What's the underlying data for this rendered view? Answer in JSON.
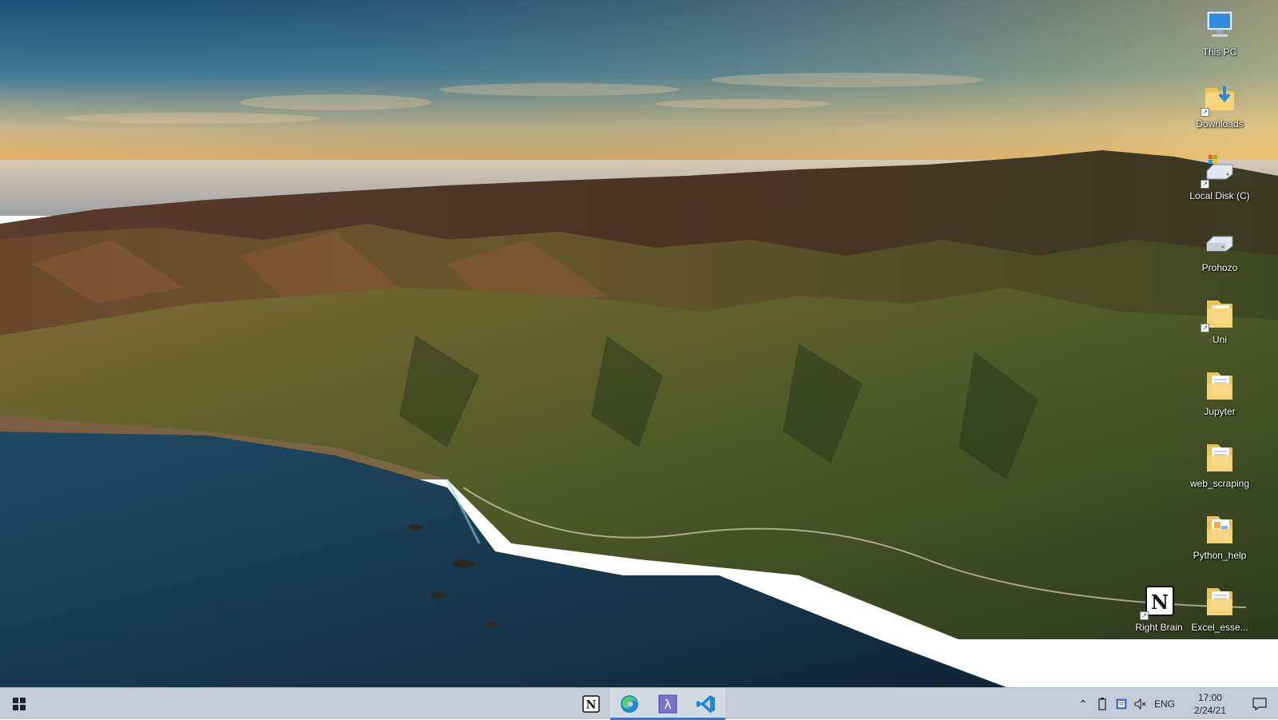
{
  "desktop": {
    "icons": [
      {
        "label": "This PC",
        "icon": "this-pc-icon"
      },
      {
        "label": "Downloads",
        "icon": "downloads-folder-icon"
      },
      {
        "label": "Local Disk (C)",
        "icon": "local-disk-icon"
      },
      {
        "label": "Prohozo",
        "icon": "drive-icon"
      },
      {
        "label": "Uni",
        "icon": "folder-icon"
      },
      {
        "label": "Jupyter",
        "icon": "folder-icon"
      },
      {
        "label": "web_scraping",
        "icon": "folder-icon"
      },
      {
        "label": "Python_help",
        "icon": "folder-icon"
      },
      {
        "label": "Right Brain",
        "icon": "notion-icon"
      },
      {
        "label": "Excel_esse...",
        "icon": "folder-icon"
      }
    ]
  },
  "taskbar": {
    "start_icon": "windows-logo-icon",
    "pinned_apps": [
      {
        "name": "Notion",
        "icon": "notion-icon",
        "active": false
      },
      {
        "name": "Microsoft Edge",
        "icon": "edge-icon",
        "active": true
      },
      {
        "name": "Lambda",
        "icon": "lambda-icon",
        "active": true
      },
      {
        "name": "Visual Studio Code",
        "icon": "vscode-icon",
        "active": true
      }
    ],
    "tray": {
      "language": "ENG",
      "time": "17:00",
      "date": "2/24/21"
    }
  },
  "colors": {
    "taskbar_bg": "#c3ccd7",
    "active_indicator": "#3a78c9",
    "icon_label": "#ffffff"
  }
}
